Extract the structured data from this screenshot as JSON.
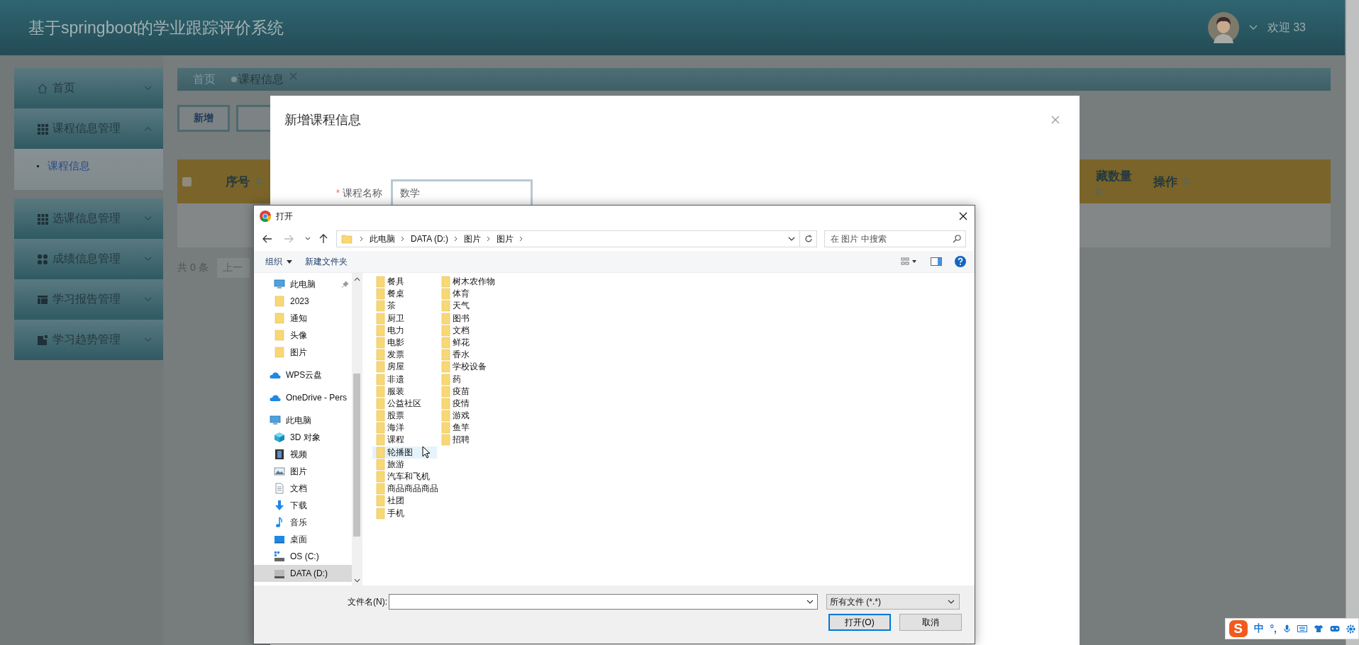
{
  "app": {
    "title": "基于springboot的学业跟踪评价系统",
    "greeting": "欢迎 33"
  },
  "sidebar": [
    {
      "label": "首页",
      "expanded": false
    },
    {
      "label": "课程信息管理",
      "expanded": true,
      "children": [
        {
          "label": "课程信息",
          "selected": true
        }
      ]
    },
    {
      "label": "选课信息管理",
      "expanded": false
    },
    {
      "label": "成绩信息管理",
      "expanded": false
    },
    {
      "label": "学习报告管理",
      "expanded": false
    },
    {
      "label": "学习趋势管理",
      "expanded": false
    }
  ],
  "breadcrumb": [
    {
      "label": "首页",
      "selected": false
    },
    {
      "label": "课程信息",
      "selected": true
    }
  ],
  "toolbar_buttons": [
    "新增"
  ],
  "table": {
    "all_checked": false,
    "columns": [
      {
        "label": "序号"
      },
      {
        "label": "藏数量"
      },
      {
        "label": "操作"
      }
    ]
  },
  "pagination": {
    "total": "共 0 条",
    "prev": "上一"
  },
  "dialog": {
    "title": "新增课程信息",
    "fields": [
      {
        "label": "课程名称",
        "required_mark": "*",
        "value": "数学"
      }
    ]
  },
  "file_dialog": {
    "title": "打开",
    "path": [
      "此电脑",
      "DATA (D:)",
      "图片",
      "图片"
    ],
    "search_placeholder": "在 图片 中搜索",
    "commands": [
      "组织",
      "新建文件夹"
    ],
    "nav_sections": [
      {
        "children": [
          {
            "label": "此电脑",
            "kind": "pc",
            "pinned": true,
            "selected": false
          },
          {
            "label": "2023",
            "kind": "folder",
            "pinned": false,
            "selected": false
          },
          {
            "label": "通知",
            "kind": "folder",
            "pinned": false,
            "selected": false
          },
          {
            "label": "头像",
            "kind": "folder",
            "pinned": false,
            "selected": false
          },
          {
            "label": "图片",
            "kind": "folder",
            "pinned": false,
            "selected": false
          }
        ]
      },
      {
        "label": "WPS云盘",
        "kind": "cloud"
      },
      {
        "label": "OneDrive - Pers",
        "kind": "cloud"
      },
      {
        "label": "此电脑",
        "kind": "pc",
        "children": [
          {
            "label": "3D 对象",
            "kind": "cube",
            "pinned": false,
            "selected": false
          },
          {
            "label": "视频",
            "kind": "video",
            "pinned": false,
            "selected": false
          },
          {
            "label": "图片",
            "kind": "picture",
            "pinned": false,
            "selected": false
          },
          {
            "label": "文档",
            "kind": "document",
            "pinned": false,
            "selected": false
          },
          {
            "label": "下载",
            "kind": "download",
            "pinned": false,
            "selected": false
          },
          {
            "label": "音乐",
            "kind": "music",
            "pinned": false,
            "selected": false
          },
          {
            "label": "桌面",
            "kind": "desktop",
            "pinned": false,
            "selected": false
          },
          {
            "label": "OS (C:)",
            "kind": "osdrive",
            "pinned": false,
            "selected": false
          },
          {
            "label": "DATA (D:)",
            "kind": "drive",
            "pinned": false,
            "selected": true
          }
        ]
      }
    ],
    "files": [
      {
        "name": "餐具",
        "hovered": false
      },
      {
        "name": "餐桌",
        "hovered": false
      },
      {
        "name": "茶",
        "hovered": false
      },
      {
        "name": "厨卫",
        "hovered": false
      },
      {
        "name": "电力",
        "hovered": false
      },
      {
        "name": "电影",
        "hovered": false
      },
      {
        "name": "发票",
        "hovered": false
      },
      {
        "name": "房屋",
        "hovered": false
      },
      {
        "name": "非遗",
        "hovered": false
      },
      {
        "name": "服装",
        "hovered": false
      },
      {
        "name": "公益社区",
        "hovered": false
      },
      {
        "name": "股票",
        "hovered": false
      },
      {
        "name": "海洋",
        "hovered": false
      },
      {
        "name": "课程",
        "hovered": false
      },
      {
        "name": "轮播图",
        "hovered": true
      },
      {
        "name": "旅游",
        "hovered": false
      },
      {
        "name": "汽车和飞机",
        "hovered": false
      },
      {
        "name": "商品商品商品",
        "hovered": false
      },
      {
        "name": "社团",
        "hovered": false
      },
      {
        "name": "手机",
        "hovered": false
      },
      {
        "name": "树木农作物",
        "hovered": false
      },
      {
        "name": "体育",
        "hovered": false
      },
      {
        "name": "天气",
        "hovered": false
      },
      {
        "name": "图书",
        "hovered": false
      },
      {
        "name": "文档",
        "hovered": false
      },
      {
        "name": "鲜花",
        "hovered": false
      },
      {
        "name": "香水",
        "hovered": false
      },
      {
        "name": "学校设备",
        "hovered": false
      },
      {
        "name": "药",
        "hovered": false
      },
      {
        "name": "疫苗",
        "hovered": false
      },
      {
        "name": "疫情",
        "hovered": false
      },
      {
        "name": "游戏",
        "hovered": false
      },
      {
        "name": "鱼竿",
        "hovered": false
      },
      {
        "name": "招聘",
        "hovered": false
      }
    ],
    "filename_label": "文件名(N):",
    "filter": "所有文件 (*.*)",
    "buttons": [
      "打开(O)",
      "取消"
    ]
  },
  "ime_bar": {
    "logo": "S",
    "items": [
      "中",
      "°,"
    ]
  }
}
